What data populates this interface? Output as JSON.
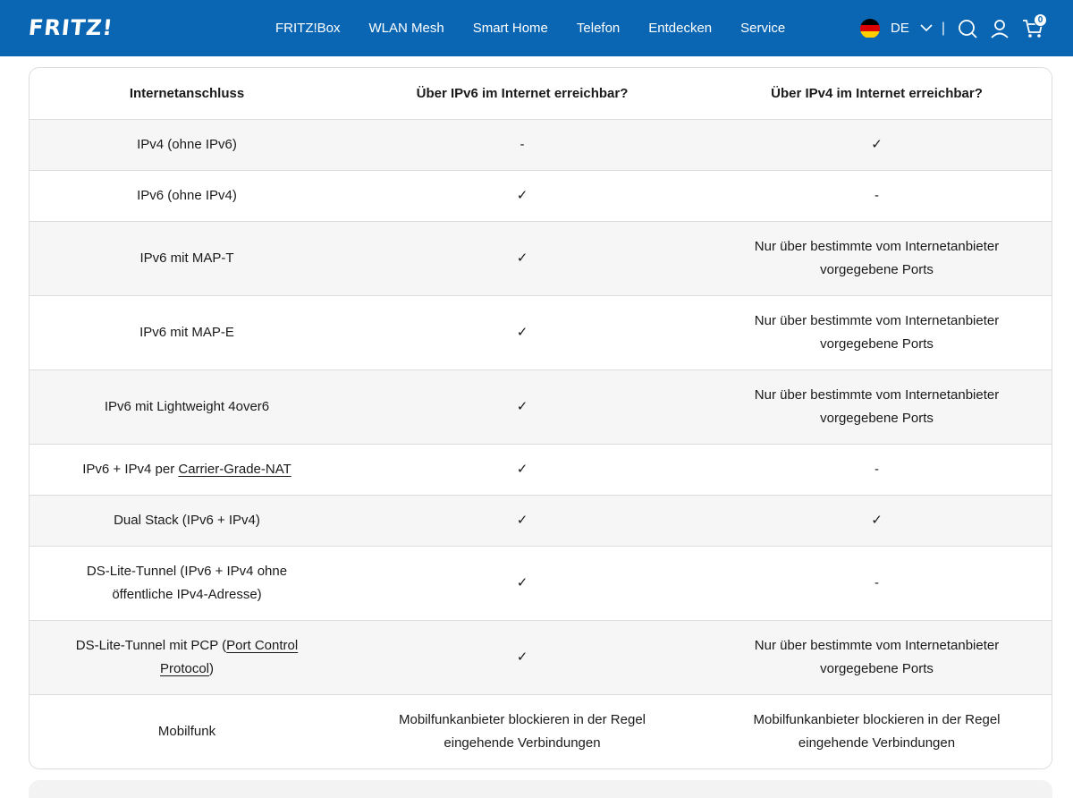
{
  "brand": {
    "logo_text": "FRITZ!",
    "primary_color": "#0a66b3"
  },
  "nav": {
    "items": [
      {
        "label": "FRITZ!Box"
      },
      {
        "label": "WLAN Mesh"
      },
      {
        "label": "Smart Home"
      },
      {
        "label": "Telefon"
      },
      {
        "label": "Entdecken"
      },
      {
        "label": "Service"
      }
    ]
  },
  "tools": {
    "language": "DE",
    "separator": "|",
    "cart_count": "0",
    "icons": [
      "flag-de-icon",
      "chevron-down-icon",
      "search-icon",
      "user-icon",
      "cart-icon"
    ]
  },
  "table": {
    "headers": [
      "Internetanschluss",
      "Über IPv6 im Internet erreichbar?",
      "Über IPv4 im Internet erreichbar?"
    ],
    "rows": [
      {
        "c1": "IPv4 (ohne IPv6)",
        "c2": "-",
        "c3": "✓"
      },
      {
        "c1": "IPv6 (ohne IPv4)",
        "c2": "✓",
        "c3": "-"
      },
      {
        "c1": "IPv6 mit MAP-T",
        "c2": "✓",
        "c3": "Nur über bestimmte vom Internetanbieter vorgegebene Ports"
      },
      {
        "c1": "IPv6 mit MAP-E",
        "c2": "✓",
        "c3": "Nur über bestimmte vom Internetanbieter vorgegebene Ports"
      },
      {
        "c1": "IPv6 mit Lightweight 4over6",
        "c2": "✓",
        "c3": "Nur über bestimmte vom Internetanbieter vorgegebene Ports"
      },
      {
        "c1_prefix": "IPv6 + IPv4 per ",
        "c1_link": "Carrier-Grade-NAT",
        "c2": "✓",
        "c3": "-"
      },
      {
        "c1": "Dual Stack (IPv6 + IPv4)",
        "c2": "✓",
        "c3": "✓"
      },
      {
        "c1": "DS-Lite-Tunnel (IPv6 + IPv4 ohne öffentliche IPv4-Adresse)",
        "c2": "✓",
        "c3": "-"
      },
      {
        "c1_prefix": "DS-Lite-Tunnel mit PCP (",
        "c1_link": "Port Control Protocol",
        "c1_suffix": ")",
        "c2": "✓",
        "c3": "Nur über bestimmte vom Internetanbieter vorgegebene Ports"
      },
      {
        "c1": "Mobilfunk",
        "c2": "Mobilfunkanbieter blockieren in der Regel eingehende Verbindungen",
        "c3": "Mobilfunkanbieter blockieren in der Regel eingehende Verbindungen"
      }
    ]
  }
}
